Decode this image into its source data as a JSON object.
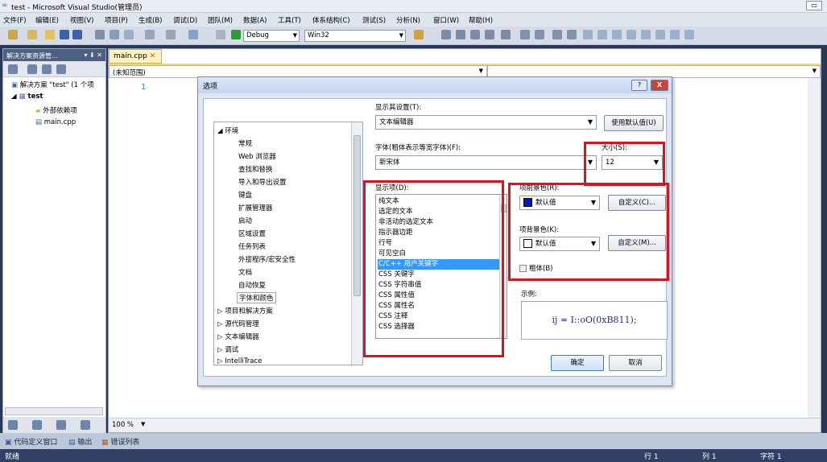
{
  "window": {
    "title": "test - Microsoft Visual Studio(管理员)"
  },
  "menu": [
    "文件(F)",
    "编辑(E)",
    "视图(V)",
    "项目(P)",
    "生成(B)",
    "调试(D)",
    "团队(M)",
    "数据(A)",
    "工具(T)",
    "体系结构(C)",
    "测试(S)",
    "分析(N)",
    "窗口(W)",
    "帮助(H)"
  ],
  "toolbar": {
    "config": "Debug",
    "platform": "Win32"
  },
  "solution_explorer": {
    "title": "解决方案资源管...",
    "pin": "▾ ⬇ ✕",
    "items": [
      "解决方案 \"test\" (1 个项",
      "test",
      "外部依赖项",
      "main.cpp"
    ]
  },
  "editor": {
    "tab": "main.cpp",
    "scope": "(未知范围)",
    "line_number": "1",
    "zoom": "100 %"
  },
  "bottom_tabs": [
    "代码定义窗口",
    "输出",
    "错误列表"
  ],
  "status": {
    "ready": "就绪",
    "row": "行 1",
    "col": "列 1",
    "char": "字符 1"
  },
  "dialog": {
    "title": "选项",
    "tree": [
      "环境",
      "常规",
      "Web 浏览器",
      "查找和替换",
      "导入和导出设置",
      "键盘",
      "扩展管理器",
      "启动",
      "区域设置",
      "任务列表",
      "外接程序/宏安全性",
      "文档",
      "自动恢复",
      "字体和颜色",
      "项目和解决方案",
      "源代码管理",
      "文本编辑器",
      "调试",
      "IntelliTrace"
    ],
    "show_settings_label": "显示其设置(T):",
    "show_settings_value": "文本编辑器",
    "use_defaults": "使用默认值(U)",
    "font_label": "字体(粗体表示等宽字体)(F):",
    "font_value": "新宋体",
    "size_label": "大小(S):",
    "size_value": "12",
    "display_items_label": "显示项(D):",
    "display_items": [
      "纯文本",
      "选定的文本",
      "非活动的选定文本",
      "指示器边距",
      "行号",
      "可见空白",
      "C/C++ 用户关键字",
      "CSS 关键字",
      "CSS 字符串值",
      "CSS 属性值",
      "CSS 属性名",
      "CSS 注释",
      "CSS 选择器"
    ],
    "selected_item": "C/C++ 用户关键字",
    "fg_label": "项前景色(R):",
    "fg_value": "默认值",
    "fg_custom": "自定义(C)...",
    "bg_label": "项背景色(K):",
    "bg_value": "默认值",
    "bg_custom": "自定义(M)...",
    "bold_label": "粗体(B)",
    "sample_label": "示例:",
    "sample_text": "ij = I::oO(0xB811);",
    "ok": "确定",
    "cancel": "取消",
    "help_btn": "?",
    "close_btn": "X"
  },
  "colors": {
    "accent": "#3399ff",
    "highlight": "#e0111b",
    "titlebar": "#293955"
  }
}
